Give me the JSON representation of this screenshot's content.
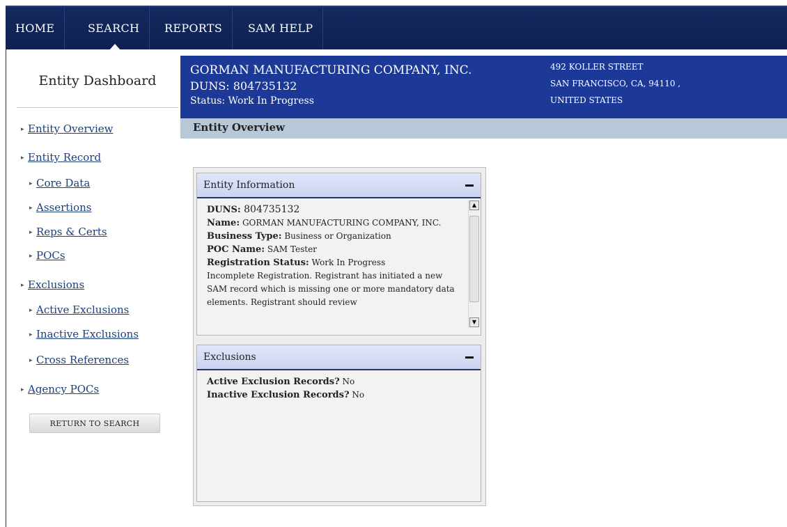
{
  "topnav": {
    "items": [
      "HOME",
      "SEARCH",
      "REPORTS",
      "SAM HELP"
    ]
  },
  "sidebar": {
    "title": "Entity Dashboard",
    "items": [
      {
        "label": "Entity Overview"
      },
      {
        "label": "Entity Record"
      },
      {
        "label": "Core Data"
      },
      {
        "label": "Assertions"
      },
      {
        "label": "Reps & Certs"
      },
      {
        "label": "POCs"
      },
      {
        "label": "Exclusions"
      },
      {
        "label": "Active Exclusions"
      },
      {
        "label": "Inactive Exclusions"
      },
      {
        "label": "Cross References"
      },
      {
        "label": "Agency POCs"
      }
    ],
    "return_button": "RETURN TO SEARCH"
  },
  "entity": {
    "name": "GORMAN MANUFACTURING COMPANY, INC.",
    "duns_line": "DUNS:  804735132",
    "status_line": "Status: Work In Progress",
    "address": [
      "492 KOLLER STREET",
      "SAN FRANCISCO, CA, 94110 ,",
      "UNITED STATES"
    ]
  },
  "section_title": "Entity Overview",
  "info_panel": {
    "title": "Entity Information",
    "rows": [
      {
        "label": "DUNS:",
        "value": " 804735132"
      },
      {
        "label": "Name:",
        "value": " GORMAN MANUFACTURING COMPANY, INC."
      },
      {
        "label": "Business Type:",
        "value": " Business or Organization"
      },
      {
        "label": "POC Name:",
        "value": " SAM Tester"
      },
      {
        "label": "Registration Status:",
        "value": " Work In Progress"
      }
    ],
    "description": "Incomplete Registration. Registrant has initiated a new SAM record which is missing one or more mandatory data elements. Registrant should review"
  },
  "exclusions_panel": {
    "title": "Exclusions",
    "rows": [
      {
        "label": "Active Exclusion Records?",
        "value": " No"
      },
      {
        "label": "Inactive Exclusion Records?",
        "value": " No"
      }
    ]
  }
}
